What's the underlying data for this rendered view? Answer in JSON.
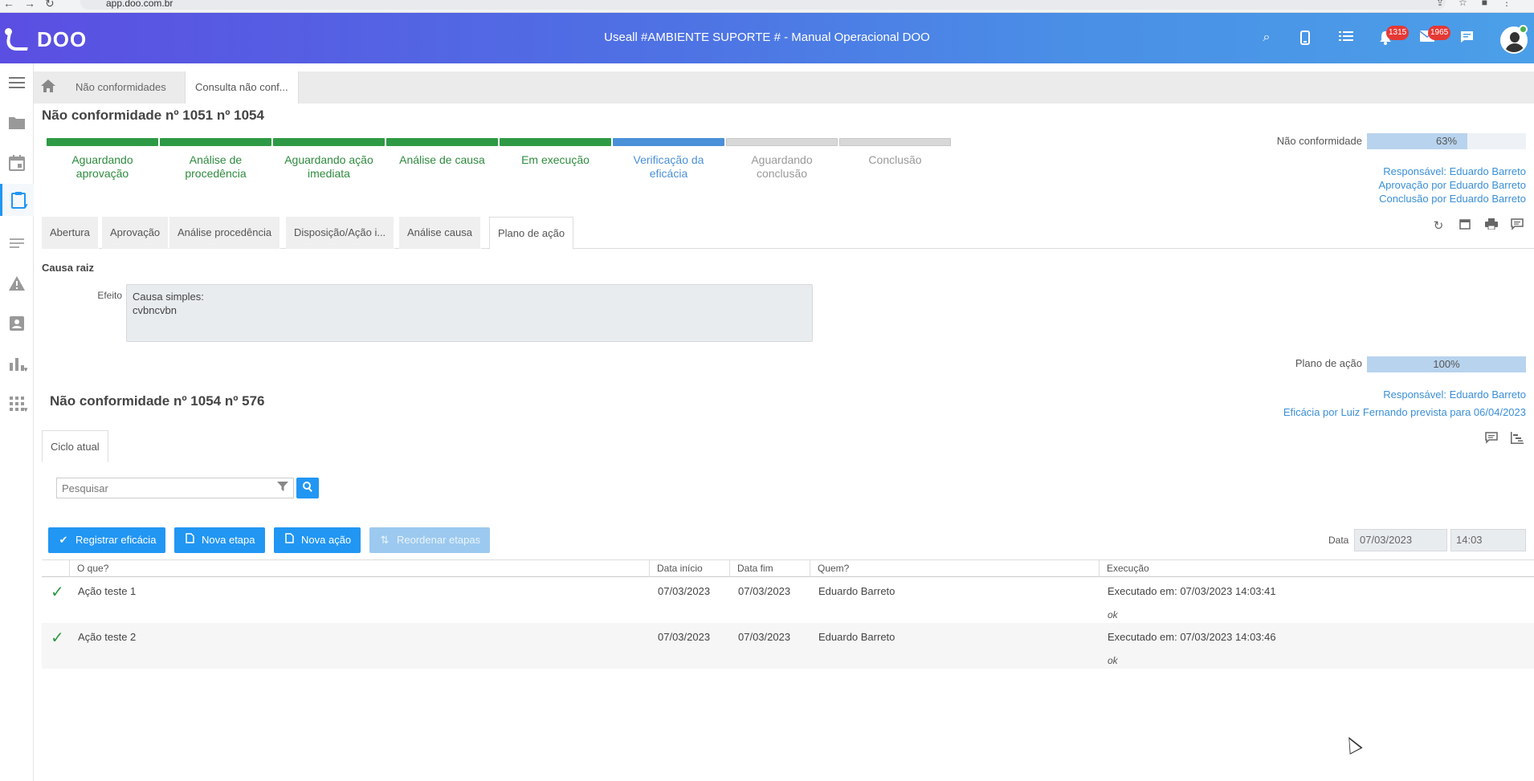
{
  "browser": {
    "url": "app.doo.com.br"
  },
  "header": {
    "logo": "DOO",
    "title": "Useall #AMBIENTE SUPORTE # - Manual Operacional DOO",
    "notifications_count": "1315",
    "messages_count": "1965"
  },
  "breadcrumb": {
    "items": [
      "Não conformidades",
      "Consulta não conf..."
    ]
  },
  "page": {
    "title": "Não conformidade nº 1051 nº 1054"
  },
  "steps": [
    {
      "label": "Aguardando aprovação",
      "state": "done"
    },
    {
      "label": "Análise de procedência",
      "state": "done"
    },
    {
      "label": "Aguardando ação imediata",
      "state": "done"
    },
    {
      "label": "Análise de causa",
      "state": "done"
    },
    {
      "label": "Em execução",
      "state": "done"
    },
    {
      "label": "Verificação da eficácia",
      "state": "current"
    },
    {
      "label": "Aguardando conclusão",
      "state": "pending"
    },
    {
      "label": "Conclusão",
      "state": "pending"
    }
  ],
  "nc_progress": {
    "label": "Não conformidade",
    "value": 63,
    "text": "63%"
  },
  "nc_info": {
    "responsavel": "Responsável: Eduardo Barreto",
    "aprovacao": "Aprovação por Eduardo Barreto",
    "conclusao": "Conclusão por Eduardo Barreto"
  },
  "tabs": [
    "Abertura",
    "Aprovação",
    "Análise procedência",
    "Disposição/Ação i...",
    "Análise causa",
    "Plano de ação"
  ],
  "active_tab": "Plano de ação",
  "causa": {
    "section": "Causa raiz",
    "field_label": "Efeito",
    "line1": "Causa simples:",
    "line2": "cvbncvbn"
  },
  "plan_progress": {
    "label": "Plano de ação",
    "value": 100,
    "text": "100%"
  },
  "plan_info": {
    "responsavel": "Responsável: Eduardo Barreto",
    "eficacia": "Eficácia por Luiz Fernando prevista para 06/04/2023"
  },
  "sub": {
    "title": "Não conformidade nº 1054 nº 576",
    "tab": "Ciclo atual"
  },
  "search": {
    "placeholder": "Pesquisar"
  },
  "buttons": {
    "registrar": "Registrar eficácia",
    "nova_etapa": "Nova etapa",
    "nova_acao": "Nova ação",
    "reordenar": "Reordenar etapas"
  },
  "date": {
    "label": "Data",
    "date": "07/03/2023",
    "time": "14:03"
  },
  "table": {
    "headers": [
      "O que?",
      "Data início",
      "Data fim",
      "Quem?",
      "Execução"
    ],
    "rows": [
      {
        "what": "Ação teste 1",
        "start": "07/03/2023",
        "end": "07/03/2023",
        "who": "Eduardo Barreto",
        "exec": "Executado em: 07/03/2023 14:03:41",
        "note": "ok"
      },
      {
        "what": "Ação teste 2",
        "start": "07/03/2023",
        "end": "07/03/2023",
        "who": "Eduardo Barreto",
        "exec": "Executado em: 07/03/2023 14:03:46",
        "note": "ok"
      }
    ]
  }
}
